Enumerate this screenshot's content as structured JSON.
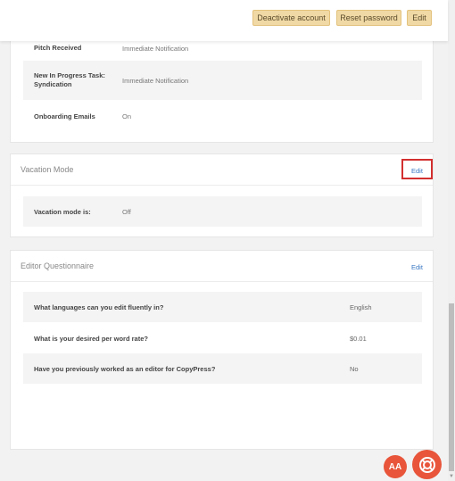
{
  "header": {
    "deactivate_label": "Deactivate account",
    "reset_label": "Reset password",
    "edit_label": "Edit"
  },
  "notifications": {
    "rows": [
      {
        "label": "Pitch Received",
        "value": "Immediate Notification"
      },
      {
        "label": "New In Progress Task: Syndication",
        "value": "Immediate Notification"
      },
      {
        "label": "Onboarding Emails",
        "value": "On"
      }
    ]
  },
  "vacation": {
    "title": "Vacation Mode",
    "edit_label": "Edit",
    "row_label": "Vacation mode is:",
    "row_value": "Off"
  },
  "questionnaire": {
    "title": "Editor Questionnaire",
    "edit_label": "Edit",
    "rows": [
      {
        "label": "What languages can you edit fluently in?",
        "value": "English"
      },
      {
        "label": "What is your desired per word rate?",
        "value": "$0.01"
      },
      {
        "label": "Have you previously worked as an editor for CopyPress?",
        "value": "No"
      }
    ]
  },
  "fab": {
    "text_size_label": "AA",
    "help_icon": "lifebuoy-icon"
  },
  "colors": {
    "accent_button": "#f0d9a5",
    "link": "#3a78c3",
    "fab": "#e8553a",
    "highlight": "#d32f2f"
  }
}
